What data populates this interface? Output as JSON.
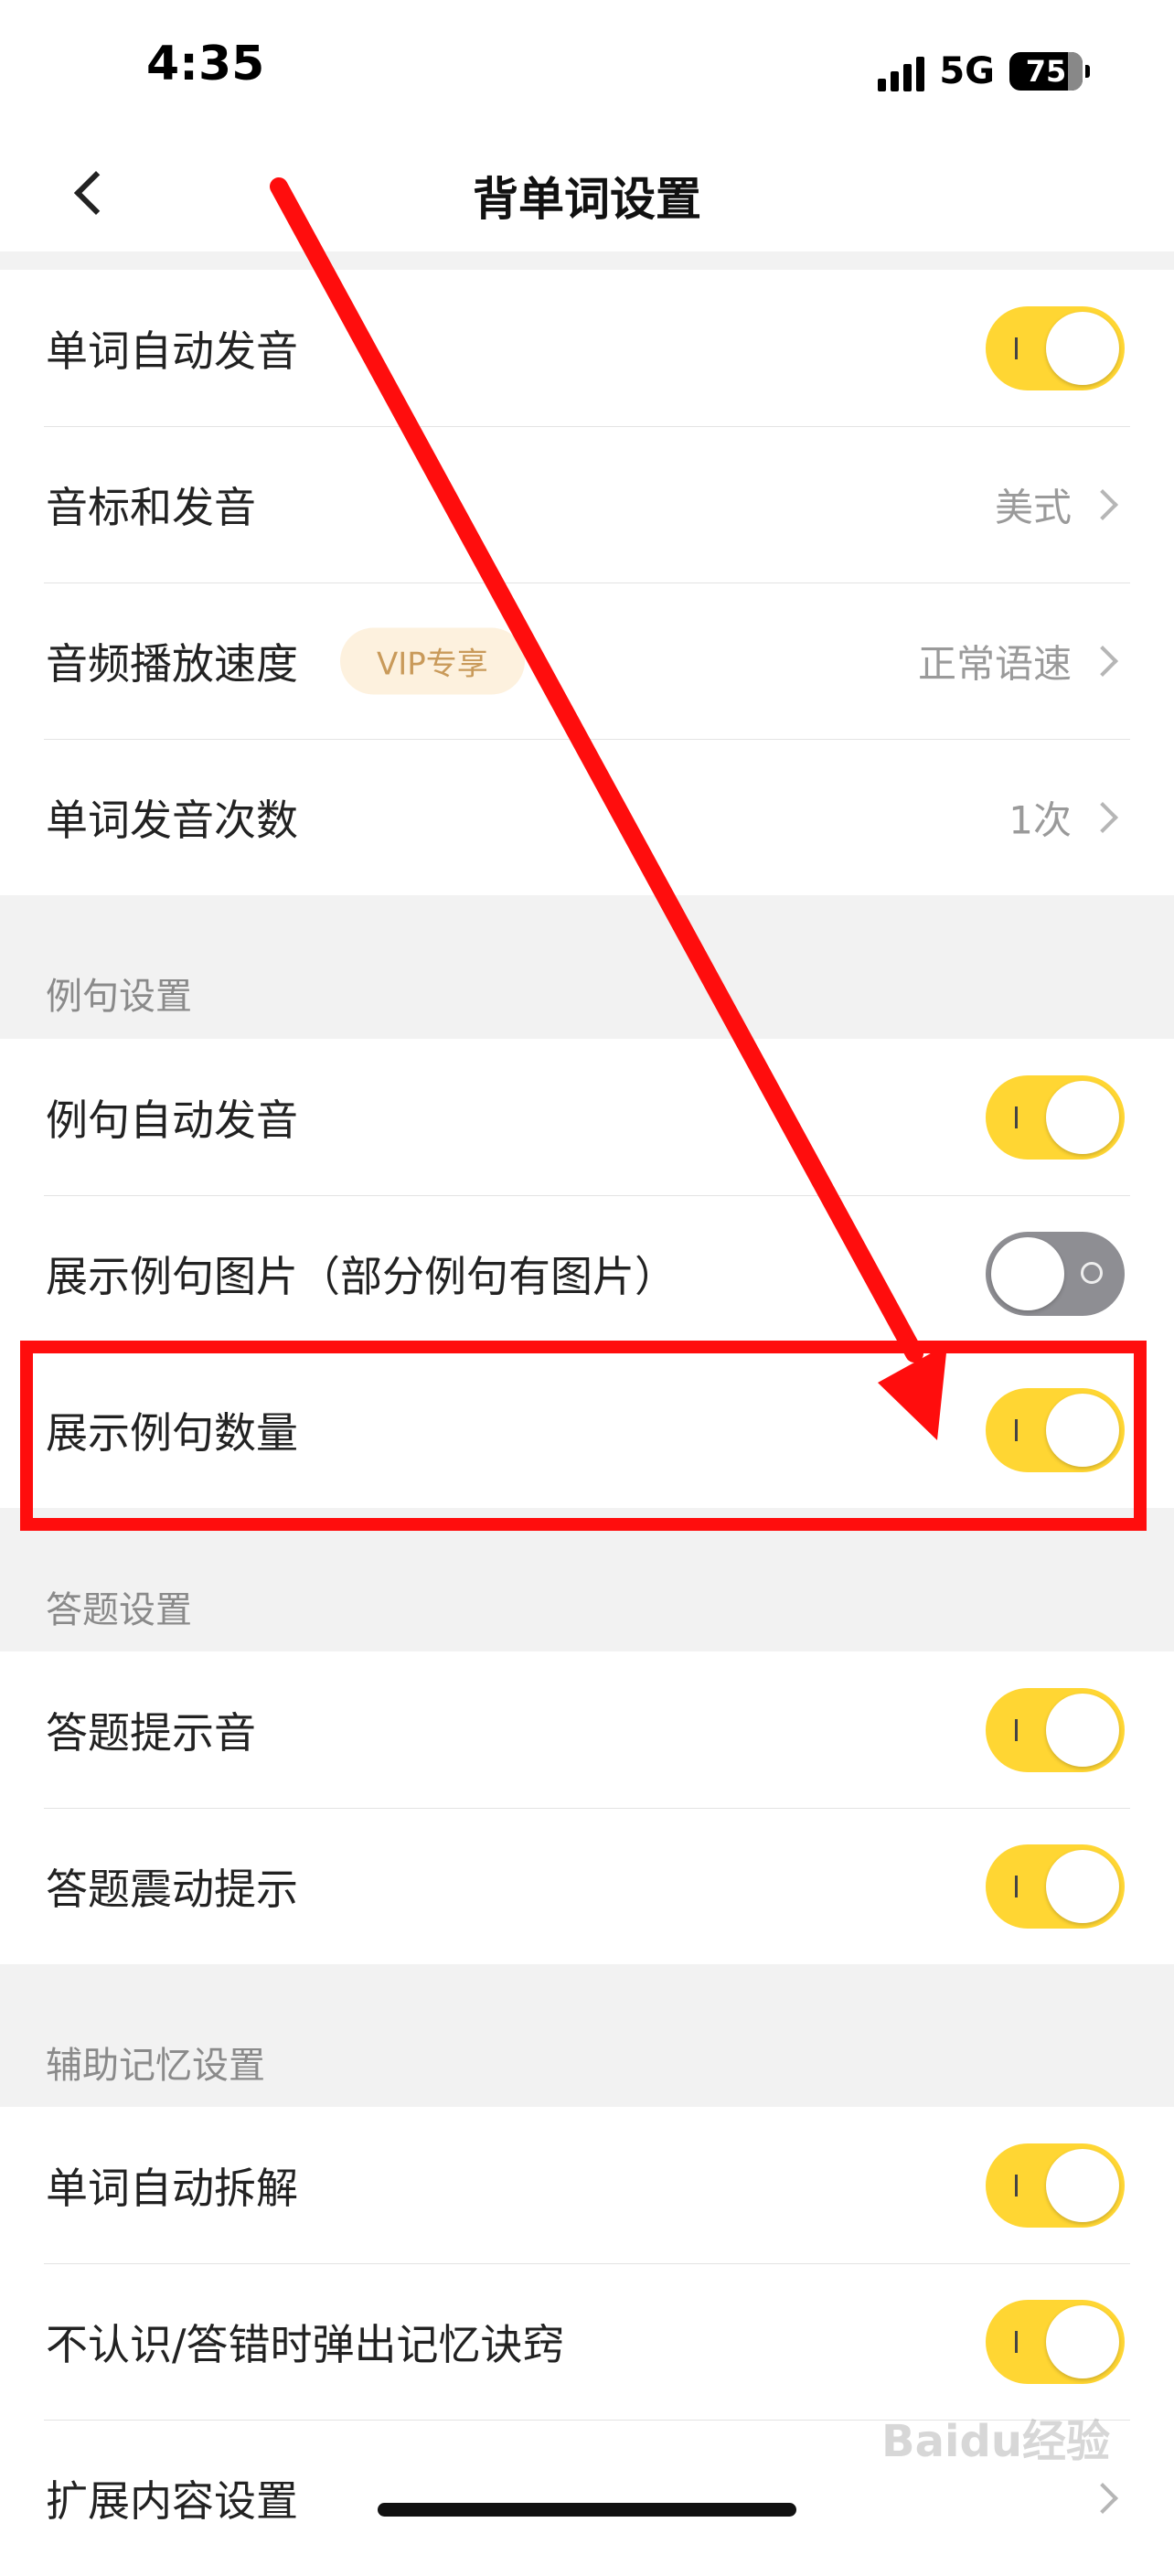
{
  "status": {
    "time": "4:35",
    "network": "5G",
    "battery": "75"
  },
  "nav": {
    "title": "背单词设置"
  },
  "sections": {
    "word": {
      "rows": [
        {
          "label": "单词自动发音",
          "toggle": "on"
        },
        {
          "label": "音标和发音",
          "value": "美式"
        },
        {
          "label": "音频播放速度",
          "badge": "VIP专享",
          "value": "正常语速"
        },
        {
          "label": "单词发音次数",
          "value": "1次"
        }
      ]
    },
    "example": {
      "title": "例句设置",
      "rows": [
        {
          "label": "例句自动发音",
          "toggle": "on"
        },
        {
          "label": "展示例句图片（部分例句有图片）",
          "toggle": "off"
        },
        {
          "label": "展示例句数量",
          "toggle": "on"
        }
      ]
    },
    "answer": {
      "title": "答题设置",
      "rows": [
        {
          "label": "答题提示音",
          "toggle": "on"
        },
        {
          "label": "答题震动提示",
          "toggle": "on"
        }
      ]
    },
    "memory": {
      "title": "辅助记忆设置",
      "rows": [
        {
          "label": "单词自动拆解",
          "toggle": "on"
        },
        {
          "label": "不认识/答错时弹出记忆诀窍",
          "toggle": "on"
        },
        {
          "label": "扩展内容设置"
        }
      ]
    }
  },
  "colors": {
    "toggle_on": "#ffd633",
    "toggle_off": "#8e8e93",
    "annotation": "#ff0d0d"
  },
  "watermark": "Baidu经验"
}
